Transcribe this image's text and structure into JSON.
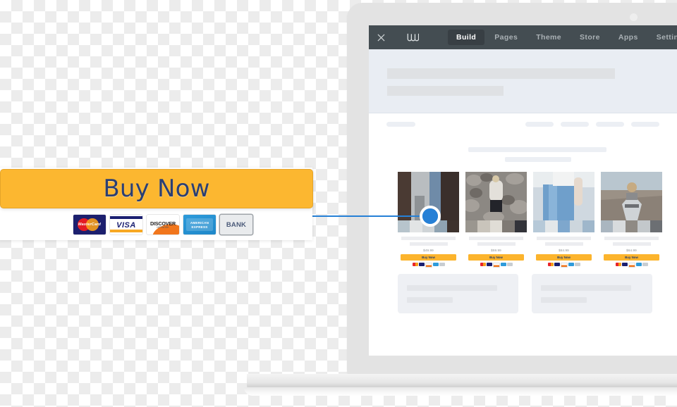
{
  "editor": {
    "close_icon": "close-icon",
    "brand_icon": "weebly-w-logo",
    "tabs": [
      {
        "label": "Build",
        "active": true
      },
      {
        "label": "Pages",
        "active": false
      },
      {
        "label": "Theme",
        "active": false
      },
      {
        "label": "Store",
        "active": false
      },
      {
        "label": "Apps",
        "active": false
      },
      {
        "label": "Settings",
        "active": false
      }
    ]
  },
  "callout": {
    "buy_now_label": "Buy Now",
    "accent_color": "#fcb730",
    "text_color": "#2b3f73",
    "connector_color": "#2680d6",
    "payment_methods": [
      {
        "name": "MasterCard",
        "label": "MasterCard"
      },
      {
        "name": "Visa",
        "label": "VISA"
      },
      {
        "name": "Discover",
        "label": "DISCOVER",
        "sub": "NETWORK"
      },
      {
        "name": "American Express",
        "label": "AMERICAN EXPRESS"
      },
      {
        "name": "Bank",
        "label": "BANK"
      }
    ]
  },
  "store": {
    "products": [
      {
        "price": "$49.99",
        "buy_label": "Buy Now"
      },
      {
        "price": "$59.99",
        "buy_label": "Buy Now"
      },
      {
        "price": "$84.99",
        "buy_label": "Buy Now"
      },
      {
        "price": "$64.99",
        "buy_label": "Buy Now"
      }
    ]
  }
}
